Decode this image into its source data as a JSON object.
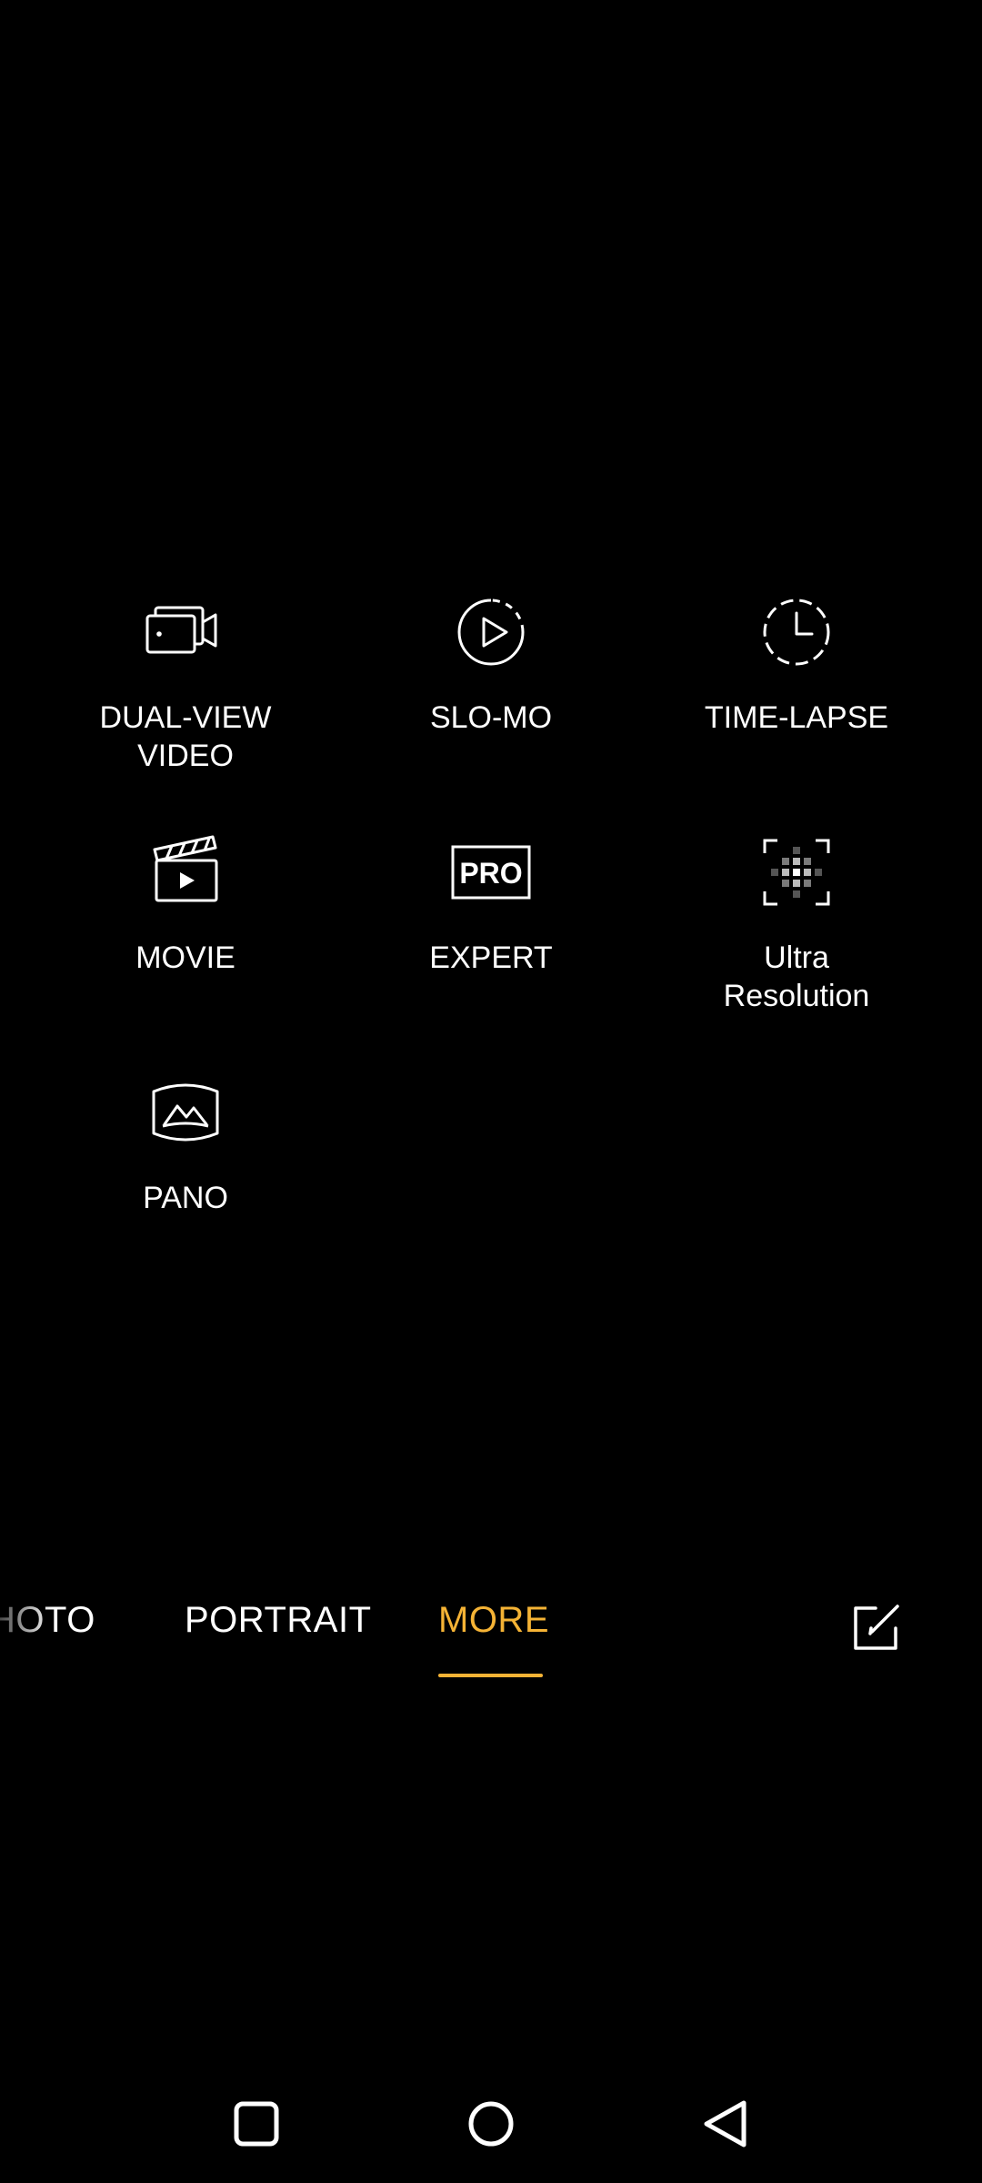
{
  "colors": {
    "accent": "#F5B335",
    "text": "#FFFFFF",
    "background": "#000000",
    "grid_dim": "#7A7A7A"
  },
  "modes": [
    {
      "label": "DUAL-VIEW\nVIDEO",
      "icon": "dual-view-video-icon"
    },
    {
      "label": "SLO-MO",
      "icon": "slo-mo-icon"
    },
    {
      "label": "TIME-LAPSE",
      "icon": "time-lapse-icon"
    },
    {
      "label": "MOVIE",
      "icon": "movie-icon"
    },
    {
      "label": "EXPERT",
      "icon": "expert-pro-icon",
      "icon_text": "PRO"
    },
    {
      "label": "Ultra\nResolution",
      "icon": "ultra-resolution-icon"
    },
    {
      "label": "PANO",
      "icon": "pano-icon"
    }
  ],
  "mode_bar": {
    "tabs": [
      {
        "label": "HOTO",
        "selected": false
      },
      {
        "label": "PORTRAIT",
        "selected": false
      },
      {
        "label": "MORE",
        "selected": true
      }
    ],
    "edit_icon": "edit-icon"
  },
  "nav_bar": {
    "recents_icon": "recents-icon",
    "home_icon": "home-icon",
    "back_icon": "back-icon"
  }
}
